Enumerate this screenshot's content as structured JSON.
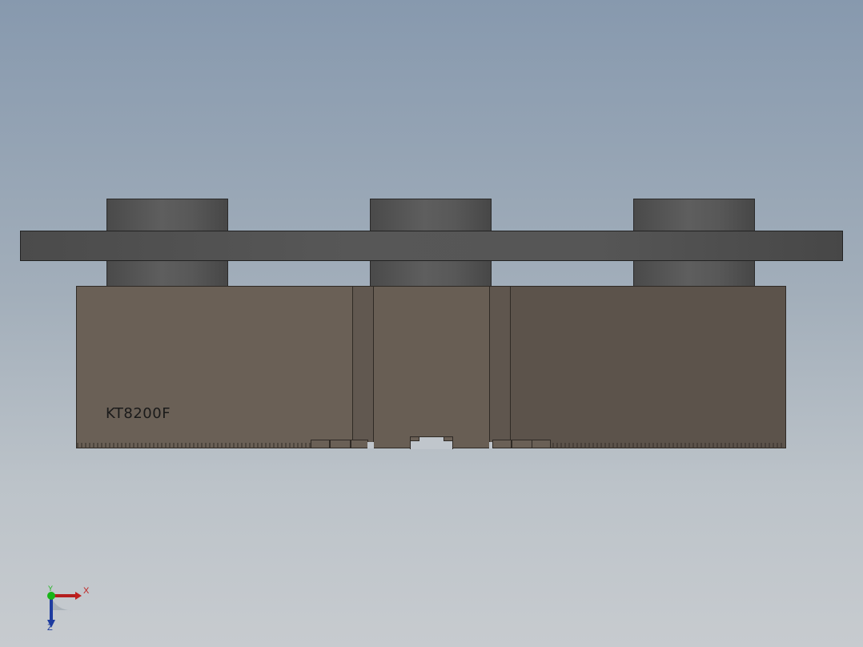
{
  "part": {
    "label": "KT8200F"
  },
  "triad": {
    "x_label": "X",
    "y_label": "Y",
    "z_label": "Z",
    "x_color": "#c0201e",
    "y_color": "#18b418",
    "z_color": "#1e3ca0"
  },
  "colors": {
    "background_top": "#8799ae",
    "background_bottom": "#c7cbcf",
    "plate": "#555555",
    "block": "#675d53"
  }
}
